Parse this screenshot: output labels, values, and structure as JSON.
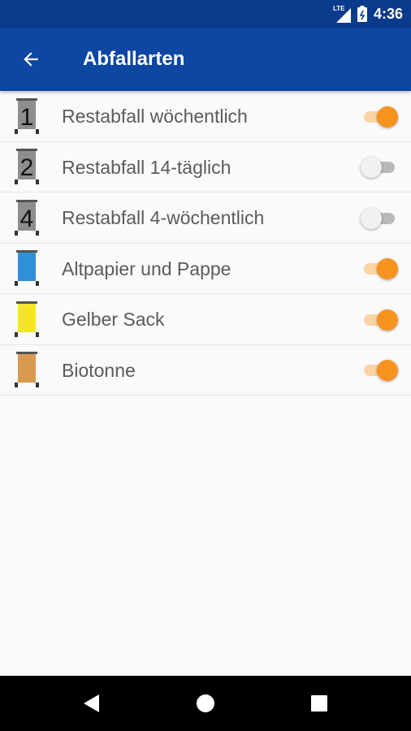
{
  "status_bar": {
    "network": "LTE",
    "time": "4:36"
  },
  "app_bar": {
    "title": "Abfallarten",
    "back_icon": "arrow-back-icon",
    "background": "#0d47a1"
  },
  "items": [
    {
      "label": "Restabfall wöchentlich",
      "bin_number": "1",
      "bin_color": "#8e8e8e",
      "enabled": true
    },
    {
      "label": "Restabfall 14-täglich",
      "bin_number": "2",
      "bin_color": "#8e8e8e",
      "enabled": false
    },
    {
      "label": "Restabfall 4-wöchentlich",
      "bin_number": "4",
      "bin_color": "#8e8e8e",
      "enabled": false
    },
    {
      "label": "Altpapier und Pappe",
      "bin_number": "",
      "bin_color": "#2f8fd8",
      "enabled": true
    },
    {
      "label": "Gelber Sack",
      "bin_number": "",
      "bin_color": "#f5e625",
      "enabled": true
    },
    {
      "label": "Biotonne",
      "bin_number": "",
      "bin_color": "#d99a50",
      "enabled": true
    }
  ],
  "colors": {
    "accent": "#f7931e",
    "status_bar": "#0a3a8a"
  },
  "nav_bar": {
    "back_icon": "triangle-back-icon",
    "home_icon": "circle-home-icon",
    "recents_icon": "square-recents-icon"
  }
}
